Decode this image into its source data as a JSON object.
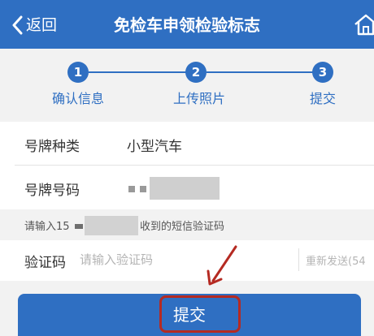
{
  "header": {
    "back_label": "返回",
    "title": "免检车申领检验标志",
    "back_icon": "chevron-left-icon",
    "home_icon": "home-icon"
  },
  "steps": [
    {
      "number": "1",
      "label": "确认信息"
    },
    {
      "number": "2",
      "label": "上传照片"
    },
    {
      "number": "3",
      "label": "提交"
    }
  ],
  "form": {
    "plate_type": {
      "label": "号牌种类",
      "value": "小型汽车"
    },
    "plate_number": {
      "label": "号牌号码"
    },
    "sms_hint": {
      "prefix": "请输入15",
      "suffix": "收到的短信验证码"
    },
    "code": {
      "label": "验证码",
      "placeholder": "请输入验证码",
      "resend_label": "重新发送(54"
    }
  },
  "submit": {
    "label": "提交"
  },
  "colors": {
    "primary": "#2f6fc2",
    "highlight": "#b52a22",
    "background": "#f2f2f2"
  }
}
